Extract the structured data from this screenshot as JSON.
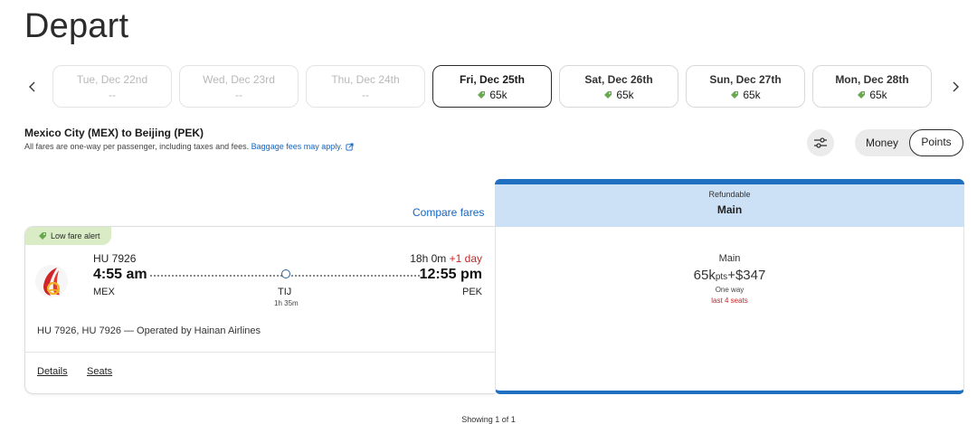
{
  "page": {
    "title": "Depart"
  },
  "dates": [
    {
      "label": "Tue, Dec 22nd",
      "price": "--",
      "state": "disabled"
    },
    {
      "label": "Wed, Dec 23rd",
      "price": "--",
      "state": "disabled"
    },
    {
      "label": "Thu, Dec 24th",
      "price": "--",
      "state": "disabled"
    },
    {
      "label": "Fri, Dec 25th",
      "price": "65k",
      "state": "selected"
    },
    {
      "label": "Sat, Dec 26th",
      "price": "65k",
      "state": "available"
    },
    {
      "label": "Sun, Dec 27th",
      "price": "65k",
      "state": "available"
    },
    {
      "label": "Mon, Dec 28th",
      "price": "65k",
      "state": "available"
    }
  ],
  "route": {
    "title": "Mexico City (MEX) to Beijing (PEK)",
    "note": "All fares are one-way per passenger, including taxes and fees.",
    "baggage_link": "Baggage fees may apply."
  },
  "toggle": {
    "money": "Money",
    "points": "Points"
  },
  "compare_fares": "Compare fares",
  "fare_header": {
    "sub": "Refundable",
    "main": "Main"
  },
  "flight": {
    "badge": "Low fare alert",
    "flight_no": "HU 7926",
    "duration": "18h 0m",
    "day_offset": "+1 day",
    "dep_time": "4:55 am",
    "arr_time": "12:55 pm",
    "dep_code": "MEX",
    "arr_code": "PEK",
    "stop_code": "TIJ",
    "stop_duration": "1h 35m",
    "operated": "HU 7926, HU 7926 — Operated by Hainan Airlines",
    "details": "Details",
    "seats": "Seats"
  },
  "fare": {
    "name": "Main",
    "points": "65k",
    "points_unit": "pts",
    "plus": "+",
    "money": "$347",
    "way": "One way",
    "seats_left": "last 4 seats"
  },
  "footer": {
    "showing": "Showing 1 of 1"
  },
  "colors": {
    "accent": "#1f70c1",
    "link": "#1565c0",
    "alert": "#c62828",
    "badge_bg": "#d9ecc6",
    "header_bg": "#cde1f6"
  }
}
